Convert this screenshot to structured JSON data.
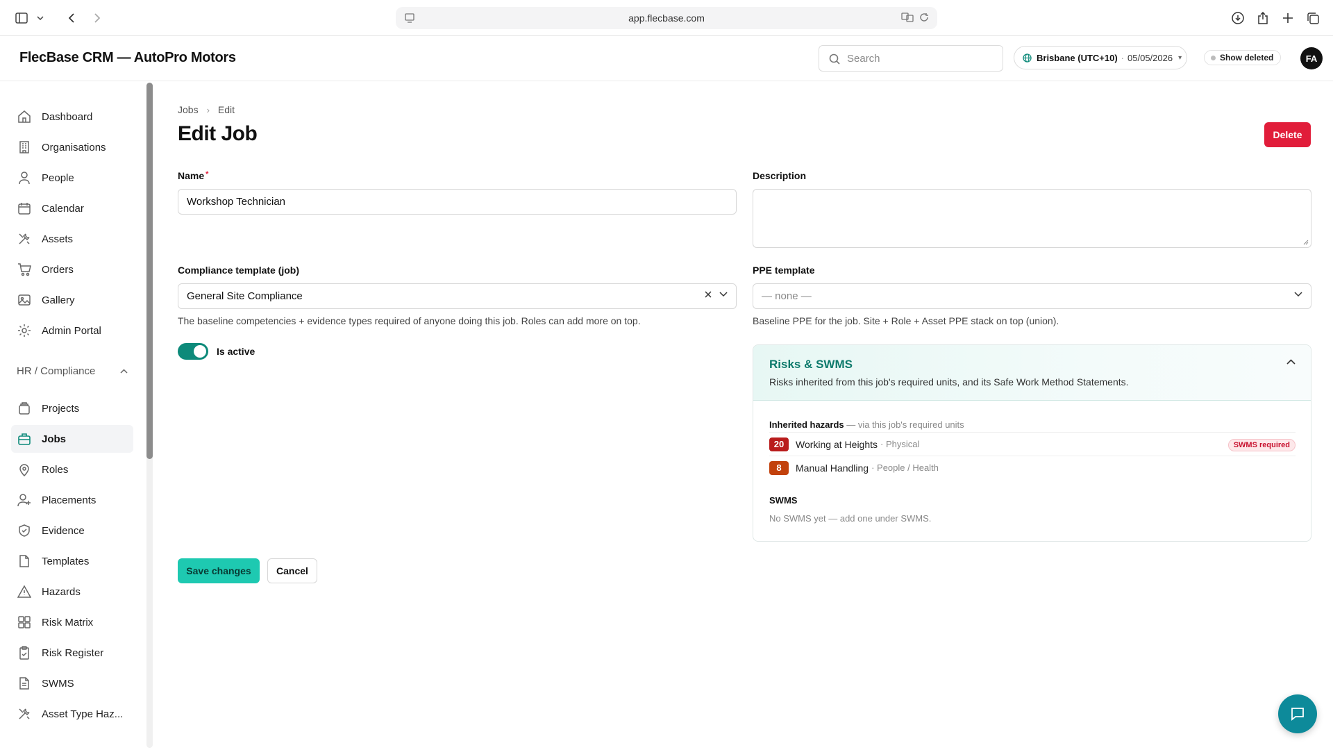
{
  "browser": {
    "url": "app.flecbase.com"
  },
  "header": {
    "title": "FlecBase CRM — AutoPro Motors",
    "search_placeholder": "Search",
    "timezone": "Brisbane (UTC+10)",
    "date": "05/05/2026",
    "show_deleted": "Show deleted",
    "avatar_initials": "FA"
  },
  "sidebar": {
    "items": [
      {
        "label": "Dashboard",
        "icon": "home-icon"
      },
      {
        "label": "Organisations",
        "icon": "building-icon"
      },
      {
        "label": "People",
        "icon": "user-icon"
      },
      {
        "label": "Calendar",
        "icon": "calendar-icon"
      },
      {
        "label": "Assets",
        "icon": "tools-icon"
      },
      {
        "label": "Orders",
        "icon": "cart-icon"
      },
      {
        "label": "Gallery",
        "icon": "image-icon"
      },
      {
        "label": "Admin Portal",
        "icon": "gear-icon"
      }
    ],
    "section": "HR / Compliance",
    "section_items": [
      {
        "label": "Projects",
        "icon": "layers-icon"
      },
      {
        "label": "Jobs",
        "icon": "briefcase-icon",
        "active": true
      },
      {
        "label": "Roles",
        "icon": "pin-icon"
      },
      {
        "label": "Placements",
        "icon": "user-plus-icon"
      },
      {
        "label": "Evidence",
        "icon": "shield-check-icon"
      },
      {
        "label": "Templates",
        "icon": "file-icon"
      },
      {
        "label": "Hazards",
        "icon": "warning-icon"
      },
      {
        "label": "Risk Matrix",
        "icon": "grid-icon"
      },
      {
        "label": "Risk Register",
        "icon": "clipboard-icon"
      },
      {
        "label": "SWMS",
        "icon": "file-text-icon"
      },
      {
        "label": "Asset Type Haz...",
        "icon": "tools-icon"
      }
    ]
  },
  "main": {
    "breadcrumb": [
      "Jobs",
      "Edit"
    ],
    "title": "Edit Job",
    "delete_label": "Delete",
    "name_label": "Name",
    "name_required": "*",
    "name_value": "Workshop Technician",
    "description_label": "Description",
    "description_value": "",
    "compliance_label": "Compliance template (job)",
    "compliance_value": "General Site Compliance",
    "compliance_help": "The baseline competencies + evidence types required of anyone doing this job. Roles can add more on top.",
    "ppe_label": "PPE template",
    "ppe_value": "— none —",
    "ppe_help": "Baseline PPE for the job. Site + Role + Asset PPE stack on top (union).",
    "active_label": "Is active",
    "active": true,
    "save_label": "Save changes",
    "cancel_label": "Cancel"
  },
  "risks": {
    "title": "Risks & SWMS",
    "subtitle": "Risks inherited from this job's required units, and its Safe Work Method Statements.",
    "inherited_title": "Inherited hazards",
    "inherited_sub": "— via this job's required units",
    "hazards": [
      {
        "score": "20",
        "name": "Working at Heights",
        "category": "· Physical",
        "color": "#b91c1c",
        "pill": "SWMS required"
      },
      {
        "score": "8",
        "name": "Manual Handling",
        "category": "· People / Health",
        "color": "#c2410c",
        "pill": ""
      }
    ],
    "swms_title": "SWMS",
    "swms_empty": "No SWMS yet — add one under SWMS."
  },
  "colors": {
    "accent": "#0d8a7a",
    "save": "#1ec9b1",
    "delete": "#e11d3a"
  }
}
